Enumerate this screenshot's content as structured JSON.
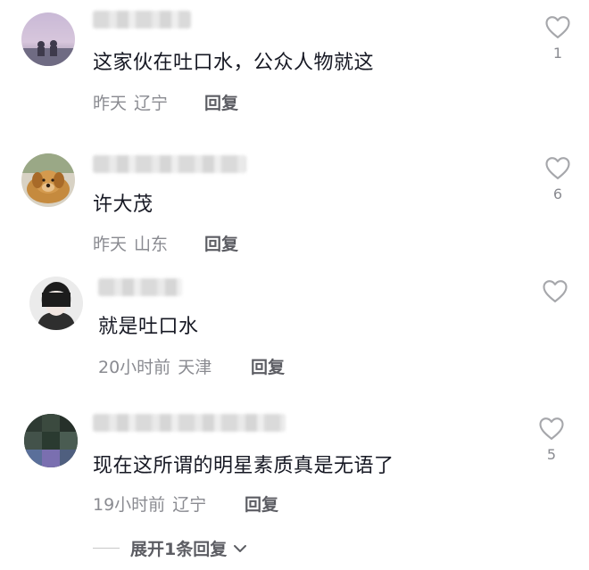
{
  "comments": [
    {
      "text": "这家伙在吐口水，公众人物就这",
      "time": "昨天",
      "location": "辽宁",
      "reply_label": "回复",
      "likes": "1"
    },
    {
      "text": "许大茂",
      "time": "昨天",
      "location": "山东",
      "reply_label": "回复",
      "likes": "6"
    },
    {
      "text": "就是吐口水",
      "time": "20小时前",
      "location": "天津",
      "reply_label": "回复",
      "likes": ""
    },
    {
      "text": "现在这所谓的明星素质真是无语了",
      "time": "19小时前",
      "location": "辽宁",
      "reply_label": "回复",
      "likes": "5"
    }
  ],
  "expand_replies_label": "展开1条回复",
  "icons": {
    "like": "heart-outline-icon",
    "expand": "chevron-down-icon"
  },
  "colors": {
    "text_primary": "#161823",
    "text_secondary": "#8a8b91",
    "icon_gray": "#a6a7ab"
  }
}
